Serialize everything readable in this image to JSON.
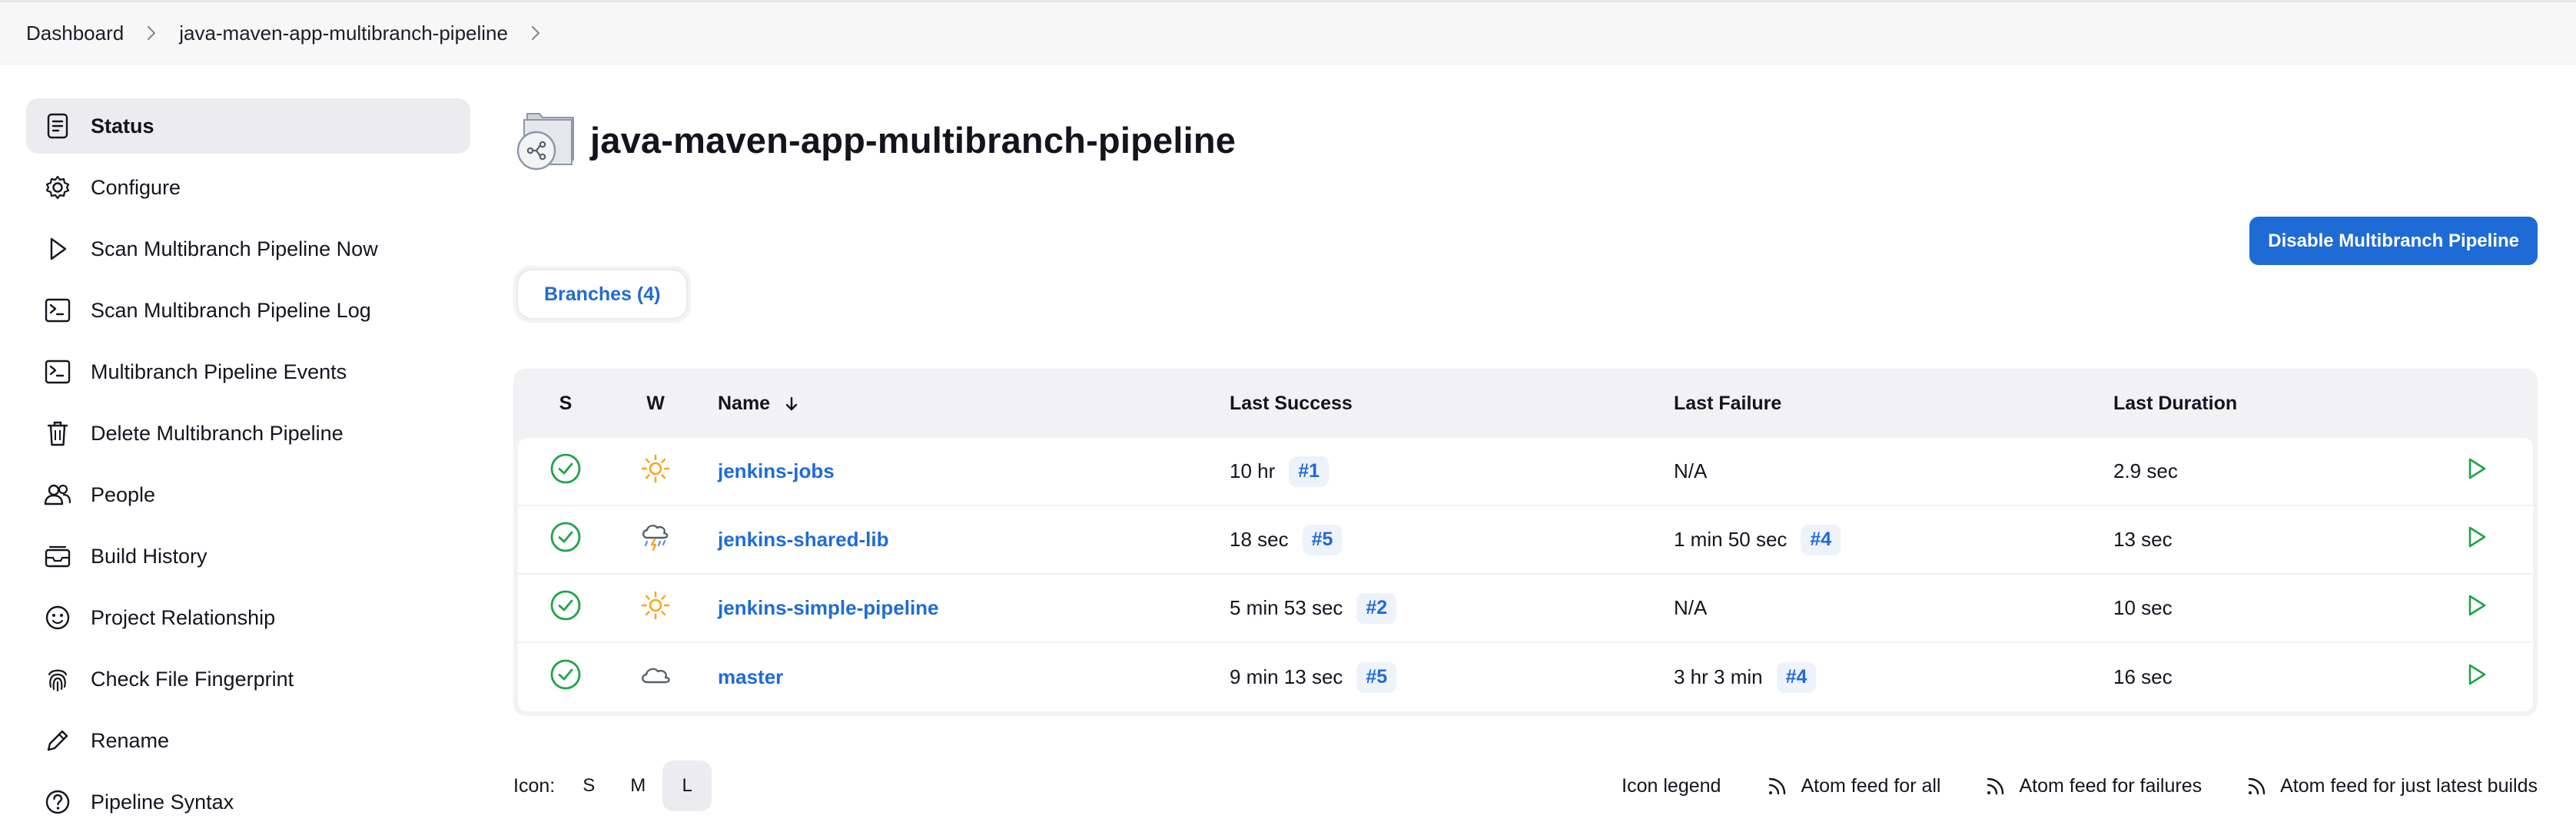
{
  "breadcrumb": {
    "items": [
      "Dashboard",
      "java-maven-app-multibranch-pipeline"
    ]
  },
  "sidebar": {
    "items": [
      {
        "label": "Status",
        "icon": "status-icon",
        "active": true
      },
      {
        "label": "Configure",
        "icon": "gear-icon"
      },
      {
        "label": "Scan Multibranch Pipeline Now",
        "icon": "play-icon"
      },
      {
        "label": "Scan Multibranch Pipeline Log",
        "icon": "terminal-icon"
      },
      {
        "label": "Multibranch Pipeline Events",
        "icon": "terminal-icon"
      },
      {
        "label": "Delete Multibranch Pipeline",
        "icon": "trash-icon"
      },
      {
        "label": "People",
        "icon": "people-icon"
      },
      {
        "label": "Build History",
        "icon": "inbox-icon"
      },
      {
        "label": "Project Relationship",
        "icon": "relationship-icon"
      },
      {
        "label": "Check File Fingerprint",
        "icon": "fingerprint-icon"
      },
      {
        "label": "Rename",
        "icon": "pencil-icon"
      },
      {
        "label": "Pipeline Syntax",
        "icon": "help-icon"
      }
    ]
  },
  "main": {
    "title": "java-maven-app-multibranch-pipeline",
    "disable_button": "Disable Multibranch Pipeline",
    "tab_label": "Branches (4)"
  },
  "table": {
    "headers": {
      "s": "S",
      "w": "W",
      "name": "Name",
      "last_success": "Last Success",
      "last_failure": "Last Failure",
      "last_duration": "Last Duration"
    },
    "rows": [
      {
        "name": "jenkins-jobs",
        "weather": "sunny",
        "success_time": "10 hr",
        "success_build": "#1",
        "failure_time": "N/A",
        "failure_build": "",
        "duration": "2.9 sec"
      },
      {
        "name": "jenkins-shared-lib",
        "weather": "storm",
        "success_time": "18 sec",
        "success_build": "#5",
        "failure_time": "1 min 50 sec",
        "failure_build": "#4",
        "duration": "13 sec"
      },
      {
        "name": "jenkins-simple-pipeline",
        "weather": "sunny",
        "success_time": "5 min 53 sec",
        "success_build": "#2",
        "failure_time": "N/A",
        "failure_build": "",
        "duration": "10 sec"
      },
      {
        "name": "master",
        "weather": "cloudy",
        "success_time": "9 min 13 sec",
        "success_build": "#5",
        "failure_time": "3 hr 3 min",
        "failure_build": "#4",
        "duration": "16 sec"
      }
    ]
  },
  "footer": {
    "icon_label": "Icon:",
    "sizes": [
      "S",
      "M",
      "L"
    ],
    "selected_size": "L",
    "legend": "Icon legend",
    "feed_all": "Atom feed for all",
    "feed_failures": "Atom feed for failures",
    "feed_latest": "Atom feed for just latest builds"
  },
  "colors": {
    "accent": "#1f6bd6",
    "success": "#1ea446",
    "sun": "#f5a623"
  }
}
